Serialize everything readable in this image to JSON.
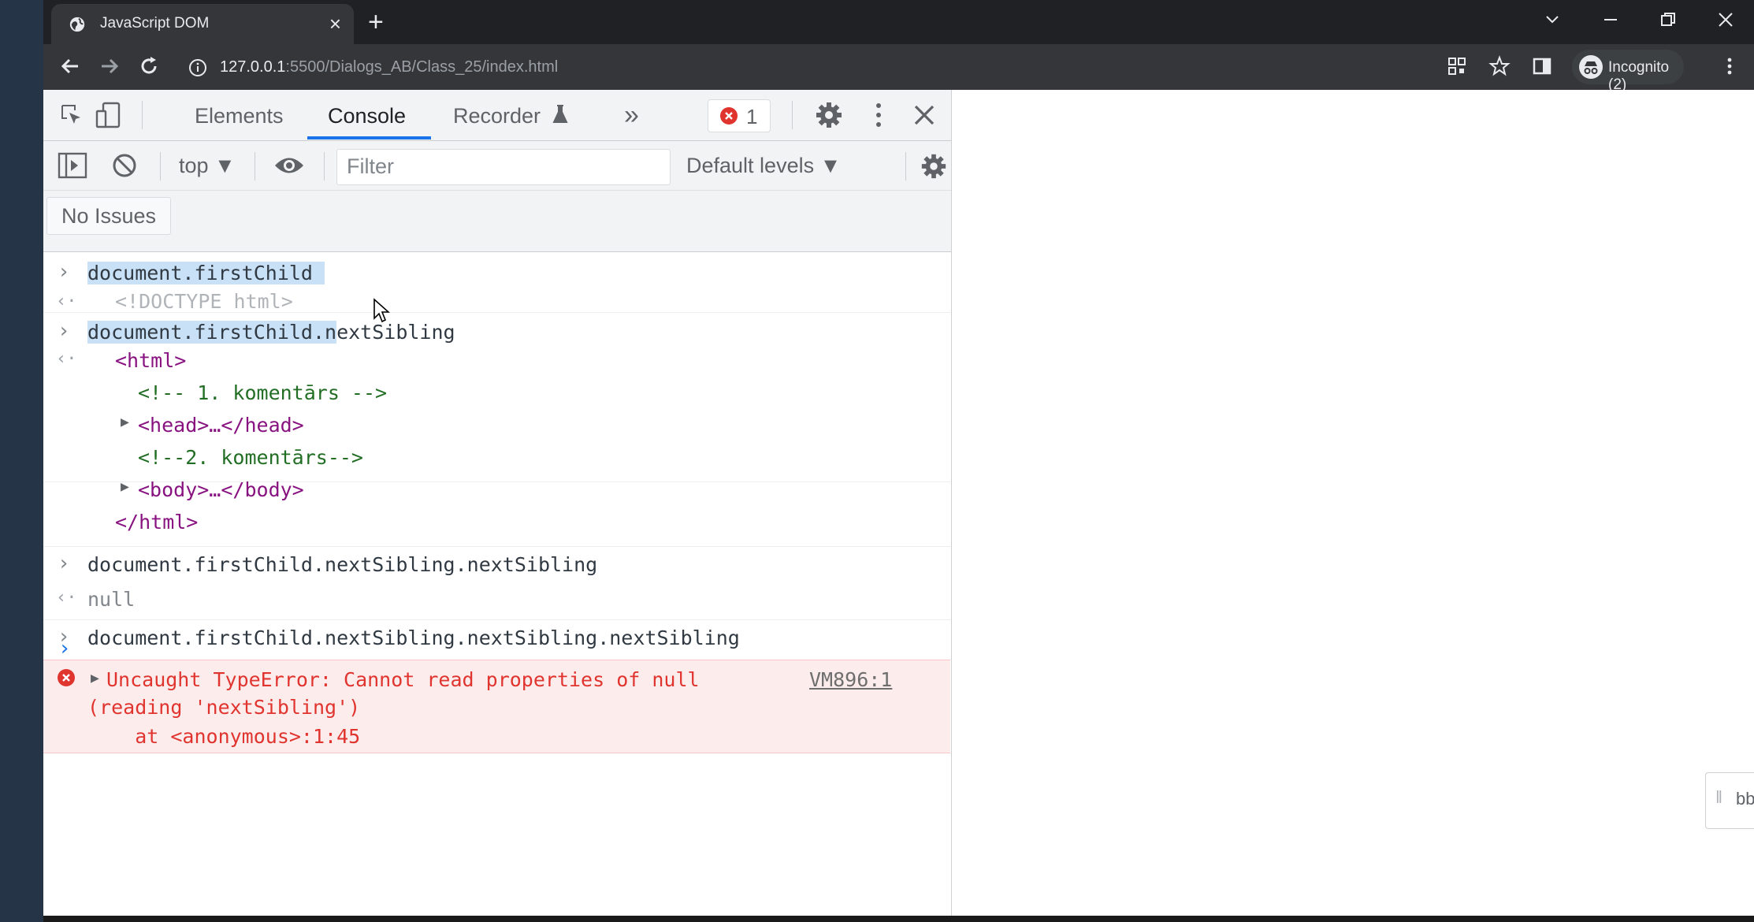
{
  "browser": {
    "tab_title": "JavaScript DOM",
    "new_tab_symbol": "+",
    "url_host": "127.0.0.1",
    "url_path": ":5500/Dialogs_AB/Class_25/index.html",
    "profile_label": "Incognito (2)"
  },
  "devtools": {
    "tabs": [
      {
        "label": "Elements",
        "active": false
      },
      {
        "label": "Console",
        "active": true
      },
      {
        "label": "Recorder",
        "active": false
      }
    ],
    "more_tabs_symbol": "»",
    "error_count": "1",
    "context": "top",
    "filter_placeholder": "Filter",
    "levels": "Default levels",
    "issues_label": "No Issues"
  },
  "console": {
    "entries": [
      {
        "input_highlighted": "document.firstChild",
        "input_rest": "",
        "output": "<!DOCTYPE html>"
      },
      {
        "input_highlighted": "document.firstChild.n",
        "input_rest": "extSibling",
        "output_tree": {
          "open": "<html>",
          "comment1": "<!-- 1. komentārs -->",
          "head": "<head>…</head>",
          "comment2": "<!--2. komentārs-->",
          "body": "<body>…</body>",
          "close": "</html>"
        }
      },
      {
        "input_highlighted": "",
        "input_rest": "document.firstChild.nextSibling.nextSibling",
        "output": "null"
      },
      {
        "input_highlighted": "",
        "input_rest": "document.firstChild.nextSibling.nextSibling.nextSibling"
      }
    ],
    "error": {
      "line1": "Uncaught TypeError: Cannot read properties of null",
      "line2": "(reading 'nextSibling')",
      "line3": "    at <anonymous>:1:45",
      "source": "VM896:1"
    }
  },
  "side_widget_text": "bb",
  "colors": {
    "accent": "#1a73e8",
    "error": "#e0342f",
    "tag": "#881280",
    "comment": "#236e25"
  }
}
